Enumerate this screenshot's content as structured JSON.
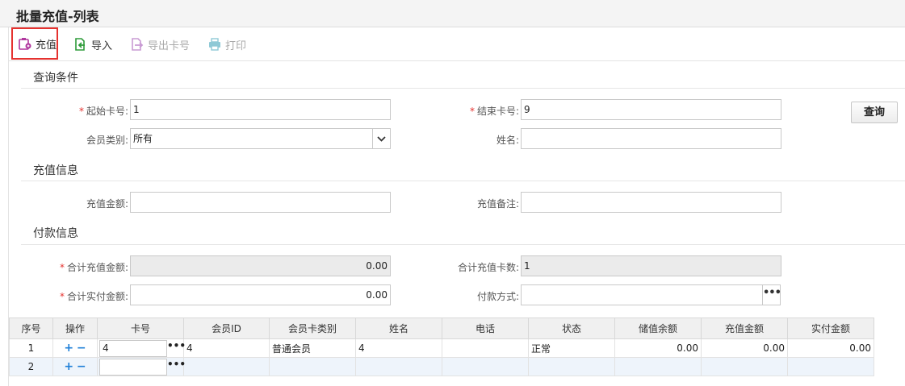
{
  "page": {
    "title": "批量充值-列表"
  },
  "toolbar": {
    "charge": "充值",
    "import": "导入",
    "export_card": "导出卡号",
    "print": "打印"
  },
  "query": {
    "section_title": "查询条件",
    "start_card_label": "起始卡号:",
    "start_card_value": "1",
    "end_card_label": "结束卡号:",
    "end_card_value": "9",
    "member_type_label": "会员类别:",
    "member_type_value": "所有",
    "name_label": "姓名:",
    "name_value": "",
    "query_button": "查询"
  },
  "recharge": {
    "section_title": "充值信息",
    "amount_label": "充值金额:",
    "amount_value": "",
    "remark_label": "充值备注:",
    "remark_value": ""
  },
  "payment": {
    "section_title": "付款信息",
    "total_recharge_label": "合计充值金额:",
    "total_recharge_value": "0.00",
    "total_cards_label": "合计充值卡数:",
    "total_cards_value": "1",
    "total_paid_label": "合计实付金额:",
    "total_paid_value": "0.00",
    "pay_method_label": "付款方式:",
    "pay_method_value": ""
  },
  "grid": {
    "columns": [
      "序号",
      "操作",
      "卡号",
      "会员ID",
      "会员卡类别",
      "姓名",
      "电话",
      "状态",
      "储值余额",
      "充值金额",
      "实付金额"
    ],
    "rows": [
      {
        "no": "1",
        "card": "4",
        "member_id": "4",
        "card_type": "普通会员",
        "name": "4",
        "phone": "",
        "status": "正常",
        "balance": "0.00",
        "recharge": "0.00",
        "paid": "0.00"
      },
      {
        "no": "2",
        "card": "",
        "member_id": "",
        "card_type": "",
        "name": "",
        "phone": "",
        "status": "",
        "balance": "",
        "recharge": "",
        "paid": ""
      }
    ],
    "plus_icon": "+",
    "minus_icon": "−",
    "more_icon": "•••"
  },
  "colors": {
    "accent_red": "#e5322f",
    "link_blue": "#1e7fd8"
  }
}
